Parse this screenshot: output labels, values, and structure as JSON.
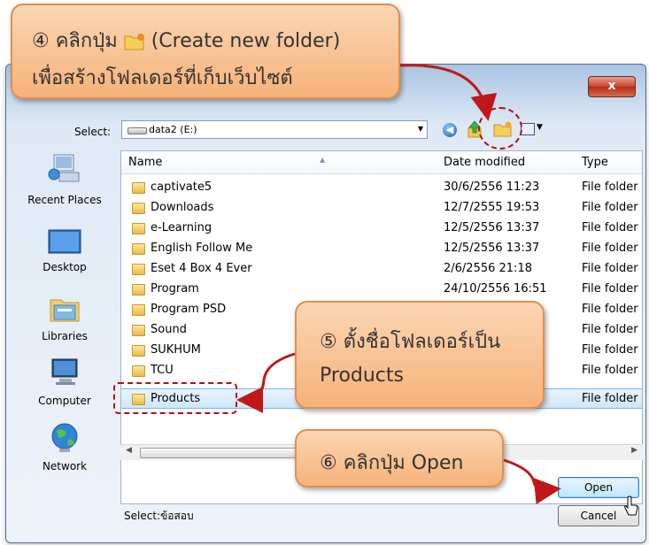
{
  "dialog": {
    "close_label": "x",
    "select_label": "Select:",
    "drive": "data2 (E:)",
    "columns": [
      "Name",
      "Date modified",
      "Type"
    ],
    "files": [
      {
        "name": "captivate5",
        "date": "30/6/2556 11:23",
        "type": "File folder"
      },
      {
        "name": "Downloads",
        "date": "12/7/2555 19:53",
        "type": "File folder"
      },
      {
        "name": "e-Learning",
        "date": "12/5/2556 13:37",
        "type": "File folder"
      },
      {
        "name": "English Follow Me",
        "date": "12/5/2556 13:37",
        "type": "File folder"
      },
      {
        "name": "Eset 4 Box 4 Ever",
        "date": "2/6/2556 21:18",
        "type": "File folder"
      },
      {
        "name": "Program",
        "date": "24/10/2556 16:51",
        "type": "File folder"
      },
      {
        "name": "Program PSD",
        "date": "",
        "type": "File folder"
      },
      {
        "name": "Sound",
        "date": "",
        "type": "File folder"
      },
      {
        "name": "SUKHUM",
        "date": "",
        "type": "File folder"
      },
      {
        "name": "TCU",
        "date": "",
        "type": "File folder"
      },
      {
        "name": "Products",
        "date": "",
        "type": "File folder"
      }
    ],
    "places": [
      "Recent Places",
      "Desktop",
      "Libraries",
      "Computer",
      "Network"
    ],
    "bottom_select": "Select:ข้อสอบ",
    "open_label": "Open",
    "cancel_label": "Cancel"
  },
  "callouts": {
    "step4_a": "④ คลิกปุ่ม",
    "step4_b": "(Create new folder)",
    "step4_line2": "เพื่อสร้างโฟลเดอร์ที่เก็บเว็บไซต์",
    "step5_line1": "⑤ ตั้งชื่อโฟลเดอร์เป็น",
    "step5_line2": "Products",
    "step6": "⑥ คลิกปุ่ม Open"
  },
  "colors": {
    "callout_fill": "#f6b27a",
    "callout_border": "#e08f4d",
    "highlight": "#b31010",
    "selection": "#cde6fb"
  }
}
